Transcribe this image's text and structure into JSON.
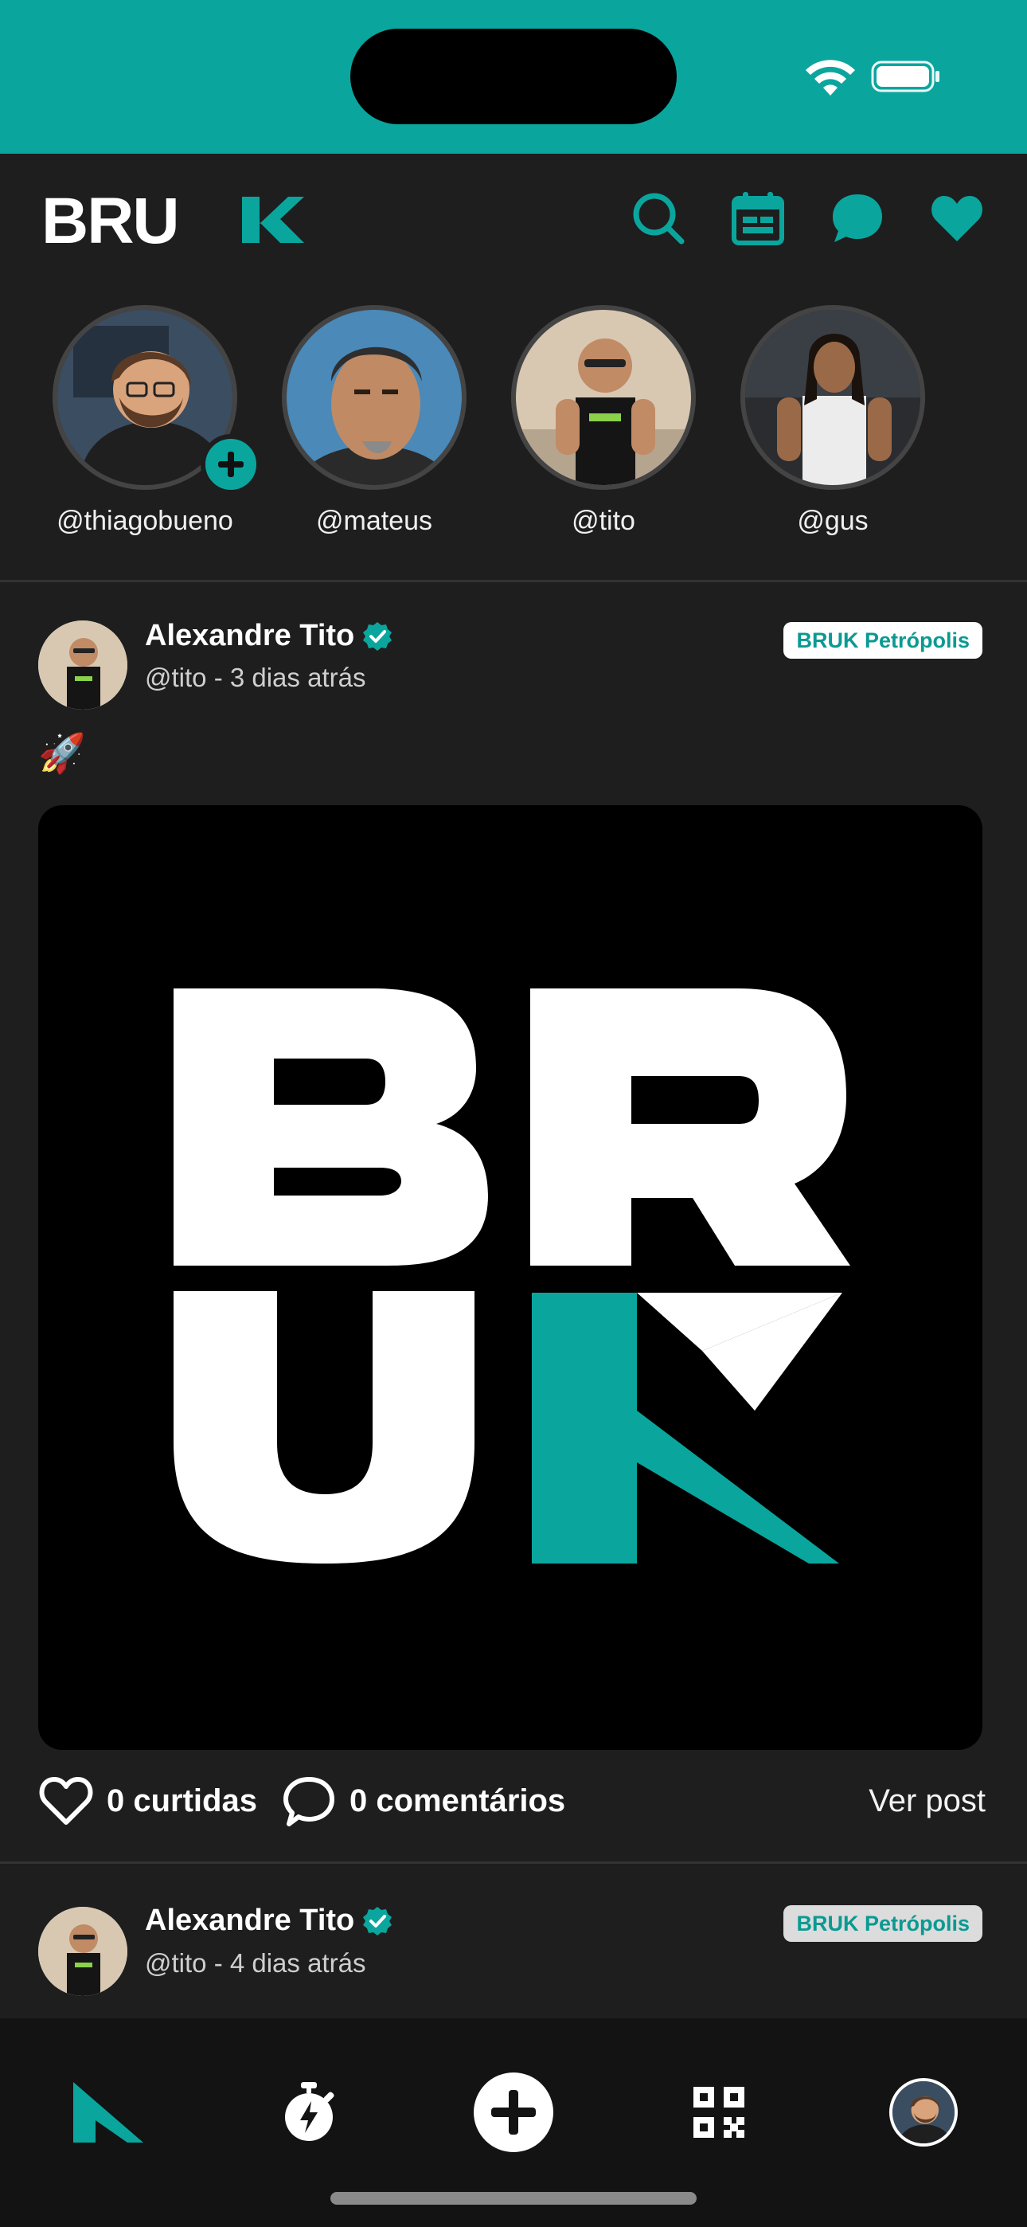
{
  "colors": {
    "accent": "#0aa69e",
    "background": "#1e1e1e",
    "nav_background": "#131313"
  },
  "app": {
    "logo_text": "BRUK"
  },
  "header": {
    "icons": [
      "search-icon",
      "calendar-icon",
      "chat-icon",
      "heart-icon"
    ]
  },
  "stories": [
    {
      "handle": "@thiagobueno",
      "has_add_badge": true
    },
    {
      "handle": "@mateus"
    },
    {
      "handle": "@tito"
    },
    {
      "handle": "@gus"
    }
  ],
  "posts": [
    {
      "author": "Alexandre Tito",
      "meta": "@tito - 3 dias atrás",
      "unit": "BRUK Petrópolis",
      "text": "🚀",
      "likes_label": "0 curtidas",
      "comments_label": "0 comentários",
      "view_label": "Ver post"
    },
    {
      "author": "Alexandre Tito",
      "meta": "@tito - 4 dias atrás",
      "unit": "BRUK Petrópolis"
    }
  ],
  "bottom_nav": {
    "items": [
      "home-logo-icon",
      "stopwatch-icon",
      "add-icon",
      "qr-code-icon",
      "profile-avatar"
    ]
  }
}
